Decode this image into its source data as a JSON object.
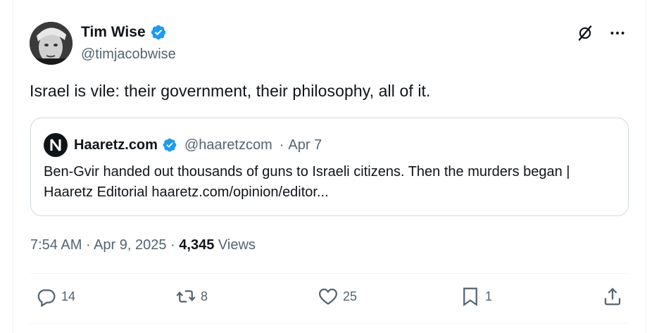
{
  "author": {
    "name": "Tim Wise",
    "handle": "@timjacobwise",
    "verified": true
  },
  "icons": {
    "verified": "verified-badge-icon",
    "grok": "grok-icon",
    "more": "more-icon",
    "reply": "reply-icon",
    "retweet": "retweet-icon",
    "like": "heart-icon",
    "bookmark": "bookmark-icon",
    "share": "share-icon"
  },
  "tweet": {
    "text": "Israel is vile: their government, their philosophy, all of it."
  },
  "quote": {
    "name": "Haaretz.com",
    "handle": "@haaretzcom",
    "separator": "·",
    "date": "Apr 7",
    "text": "Ben-Gvir handed out thousands of guns to Israeli citizens. Then the murders began | Haaretz Editorial haaretz.com/opinion/editor..."
  },
  "meta": {
    "time": "7:54 AM",
    "sep1": "·",
    "date": "Apr 9, 2025",
    "sep2": "·",
    "views_count": "4,345",
    "views_label": "Views"
  },
  "actions": {
    "replies": "14",
    "retweets": "8",
    "likes": "25",
    "bookmarks": "1"
  },
  "colors": {
    "text": "#0f1419",
    "secondary": "#536471",
    "verified": "#1d9bf0",
    "border": "#cfd9de"
  }
}
